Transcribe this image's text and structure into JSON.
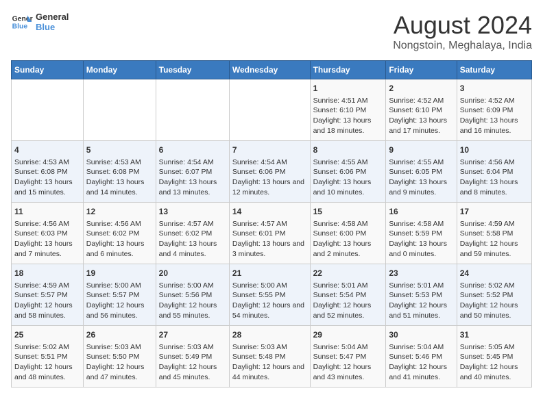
{
  "logo": {
    "line1": "General",
    "line2": "Blue"
  },
  "title": "August 2024",
  "subtitle": "Nongstoin, Meghalaya, India",
  "days_of_week": [
    "Sunday",
    "Monday",
    "Tuesday",
    "Wednesday",
    "Thursday",
    "Friday",
    "Saturday"
  ],
  "weeks": [
    [
      {
        "day": "",
        "content": ""
      },
      {
        "day": "",
        "content": ""
      },
      {
        "day": "",
        "content": ""
      },
      {
        "day": "",
        "content": ""
      },
      {
        "day": "1",
        "content": "Sunrise: 4:51 AM\nSunset: 6:10 PM\nDaylight: 13 hours and 18 minutes."
      },
      {
        "day": "2",
        "content": "Sunrise: 4:52 AM\nSunset: 6:10 PM\nDaylight: 13 hours and 17 minutes."
      },
      {
        "day": "3",
        "content": "Sunrise: 4:52 AM\nSunset: 6:09 PM\nDaylight: 13 hours and 16 minutes."
      }
    ],
    [
      {
        "day": "4",
        "content": "Sunrise: 4:53 AM\nSunset: 6:08 PM\nDaylight: 13 hours and 15 minutes."
      },
      {
        "day": "5",
        "content": "Sunrise: 4:53 AM\nSunset: 6:08 PM\nDaylight: 13 hours and 14 minutes."
      },
      {
        "day": "6",
        "content": "Sunrise: 4:54 AM\nSunset: 6:07 PM\nDaylight: 13 hours and 13 minutes."
      },
      {
        "day": "7",
        "content": "Sunrise: 4:54 AM\nSunset: 6:06 PM\nDaylight: 13 hours and 12 minutes."
      },
      {
        "day": "8",
        "content": "Sunrise: 4:55 AM\nSunset: 6:06 PM\nDaylight: 13 hours and 10 minutes."
      },
      {
        "day": "9",
        "content": "Sunrise: 4:55 AM\nSunset: 6:05 PM\nDaylight: 13 hours and 9 minutes."
      },
      {
        "day": "10",
        "content": "Sunrise: 4:56 AM\nSunset: 6:04 PM\nDaylight: 13 hours and 8 minutes."
      }
    ],
    [
      {
        "day": "11",
        "content": "Sunrise: 4:56 AM\nSunset: 6:03 PM\nDaylight: 13 hours and 7 minutes."
      },
      {
        "day": "12",
        "content": "Sunrise: 4:56 AM\nSunset: 6:02 PM\nDaylight: 13 hours and 6 minutes."
      },
      {
        "day": "13",
        "content": "Sunrise: 4:57 AM\nSunset: 6:02 PM\nDaylight: 13 hours and 4 minutes."
      },
      {
        "day": "14",
        "content": "Sunrise: 4:57 AM\nSunset: 6:01 PM\nDaylight: 13 hours and 3 minutes."
      },
      {
        "day": "15",
        "content": "Sunrise: 4:58 AM\nSunset: 6:00 PM\nDaylight: 13 hours and 2 minutes."
      },
      {
        "day": "16",
        "content": "Sunrise: 4:58 AM\nSunset: 5:59 PM\nDaylight: 13 hours and 0 minutes."
      },
      {
        "day": "17",
        "content": "Sunrise: 4:59 AM\nSunset: 5:58 PM\nDaylight: 12 hours and 59 minutes."
      }
    ],
    [
      {
        "day": "18",
        "content": "Sunrise: 4:59 AM\nSunset: 5:57 PM\nDaylight: 12 hours and 58 minutes."
      },
      {
        "day": "19",
        "content": "Sunrise: 5:00 AM\nSunset: 5:57 PM\nDaylight: 12 hours and 56 minutes."
      },
      {
        "day": "20",
        "content": "Sunrise: 5:00 AM\nSunset: 5:56 PM\nDaylight: 12 hours and 55 minutes."
      },
      {
        "day": "21",
        "content": "Sunrise: 5:00 AM\nSunset: 5:55 PM\nDaylight: 12 hours and 54 minutes."
      },
      {
        "day": "22",
        "content": "Sunrise: 5:01 AM\nSunset: 5:54 PM\nDaylight: 12 hours and 52 minutes."
      },
      {
        "day": "23",
        "content": "Sunrise: 5:01 AM\nSunset: 5:53 PM\nDaylight: 12 hours and 51 minutes."
      },
      {
        "day": "24",
        "content": "Sunrise: 5:02 AM\nSunset: 5:52 PM\nDaylight: 12 hours and 50 minutes."
      }
    ],
    [
      {
        "day": "25",
        "content": "Sunrise: 5:02 AM\nSunset: 5:51 PM\nDaylight: 12 hours and 48 minutes."
      },
      {
        "day": "26",
        "content": "Sunrise: 5:03 AM\nSunset: 5:50 PM\nDaylight: 12 hours and 47 minutes."
      },
      {
        "day": "27",
        "content": "Sunrise: 5:03 AM\nSunset: 5:49 PM\nDaylight: 12 hours and 45 minutes."
      },
      {
        "day": "28",
        "content": "Sunrise: 5:03 AM\nSunset: 5:48 PM\nDaylight: 12 hours and 44 minutes."
      },
      {
        "day": "29",
        "content": "Sunrise: 5:04 AM\nSunset: 5:47 PM\nDaylight: 12 hours and 43 minutes."
      },
      {
        "day": "30",
        "content": "Sunrise: 5:04 AM\nSunset: 5:46 PM\nDaylight: 12 hours and 41 minutes."
      },
      {
        "day": "31",
        "content": "Sunrise: 5:05 AM\nSunset: 5:45 PM\nDaylight: 12 hours and 40 minutes."
      }
    ]
  ]
}
